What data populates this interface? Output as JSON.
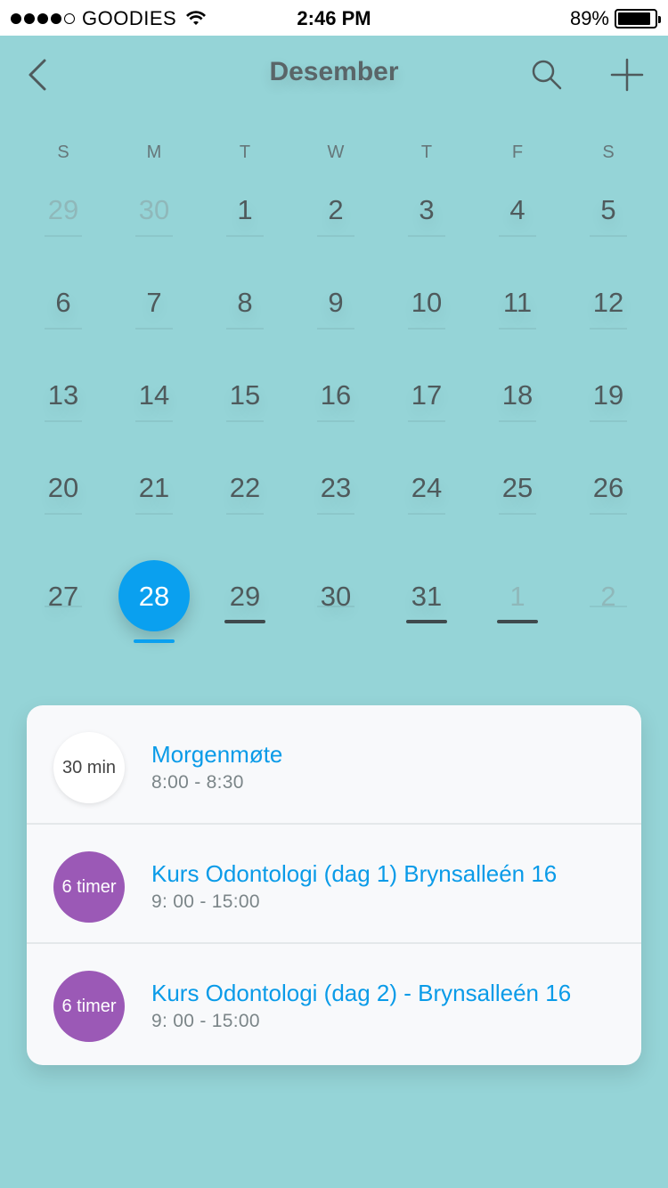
{
  "status": {
    "carrier": "GOODIES",
    "time": "2:46 PM",
    "battery": "89%",
    "battery_level": 0.89
  },
  "header": {
    "title": "Desember",
    "back_icon": "chevron-left-icon",
    "search_icon": "search-icon",
    "add_icon": "plus-icon"
  },
  "weekdays": [
    "S",
    "M",
    "T",
    "W",
    "T",
    "F",
    "S"
  ],
  "weeks": [
    [
      {
        "d": "29",
        "muted": true,
        "event": false
      },
      {
        "d": "30",
        "muted": true,
        "event": false
      },
      {
        "d": "1",
        "muted": false,
        "event": false
      },
      {
        "d": "2",
        "muted": false,
        "event": false
      },
      {
        "d": "3",
        "muted": false,
        "event": false
      },
      {
        "d": "4",
        "muted": false,
        "event": false
      },
      {
        "d": "5",
        "muted": false,
        "event": false
      }
    ],
    [
      {
        "d": "6",
        "muted": false,
        "event": false
      },
      {
        "d": "7",
        "muted": false,
        "event": false
      },
      {
        "d": "8",
        "muted": false,
        "event": false
      },
      {
        "d": "9",
        "muted": false,
        "event": false
      },
      {
        "d": "10",
        "muted": false,
        "event": false
      },
      {
        "d": "11",
        "muted": false,
        "event": false
      },
      {
        "d": "12",
        "muted": false,
        "event": false
      }
    ],
    [
      {
        "d": "13",
        "muted": false,
        "event": false
      },
      {
        "d": "14",
        "muted": false,
        "event": false
      },
      {
        "d": "15",
        "muted": false,
        "event": false
      },
      {
        "d": "16",
        "muted": false,
        "event": false
      },
      {
        "d": "17",
        "muted": false,
        "event": false
      },
      {
        "d": "18",
        "muted": false,
        "event": false
      },
      {
        "d": "19",
        "muted": false,
        "event": false
      }
    ],
    [
      {
        "d": "20",
        "muted": false,
        "event": false
      },
      {
        "d": "21",
        "muted": false,
        "event": false
      },
      {
        "d": "22",
        "muted": false,
        "event": false
      },
      {
        "d": "23",
        "muted": false,
        "event": false
      },
      {
        "d": "24",
        "muted": false,
        "event": false
      },
      {
        "d": "25",
        "muted": false,
        "event": false
      },
      {
        "d": "26",
        "muted": false,
        "event": false
      }
    ],
    [
      {
        "d": "27",
        "muted": false,
        "event": false
      },
      {
        "d": "28",
        "muted": false,
        "event": false,
        "selected": true
      },
      {
        "d": "29",
        "muted": false,
        "event": true
      },
      {
        "d": "30",
        "muted": false,
        "event": false
      },
      {
        "d": "31",
        "muted": false,
        "event": true
      },
      {
        "d": "1",
        "muted": true,
        "event": true
      },
      {
        "d": "2",
        "muted": true,
        "event": false
      }
    ]
  ],
  "events": [
    {
      "badge": "30 min",
      "badge_color": "white",
      "title": "Morgenmøte",
      "time": "8:00 - 8:30"
    },
    {
      "badge": "6 timer",
      "badge_color": "purple",
      "title": "Kurs Odontologi (dag 1) Brynsalleén 16",
      "time": "9: 00 - 15:00"
    },
    {
      "badge": "6 timer",
      "badge_color": "purple",
      "title": "Kurs Odontologi (dag 2) - Brynsalleén 16",
      "time": "9: 00 - 15:00"
    }
  ],
  "colors": {
    "background": "#95d4d7",
    "accent": "#0aa0ef",
    "purple": "#9b59b6"
  }
}
